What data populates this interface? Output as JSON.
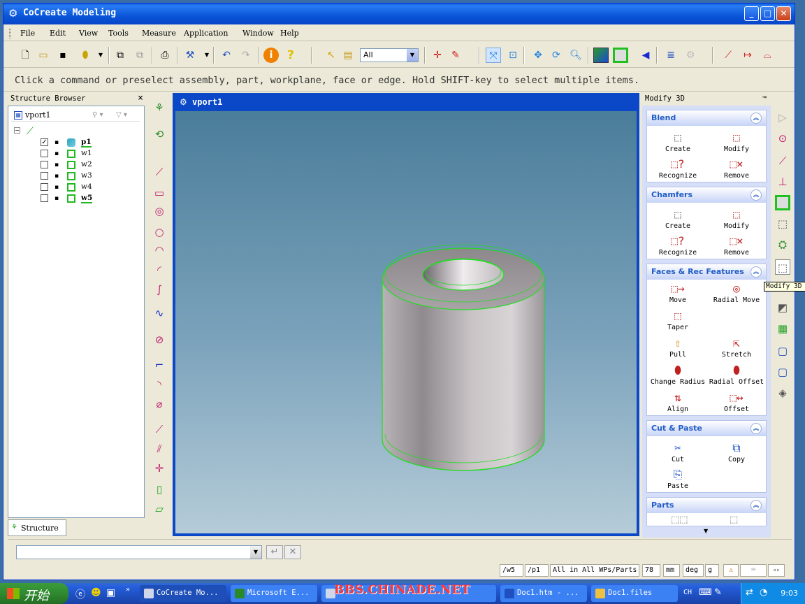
{
  "window": {
    "title": "CoCreate Modeling",
    "controls": {
      "minimize": "_",
      "maximize": "□",
      "close": "✕"
    }
  },
  "menu": [
    "File",
    "Edit",
    "View",
    "Tools",
    "Measure",
    "Application",
    "Window",
    "Help"
  ],
  "toolbar": {
    "filter_value": "All",
    "icons": [
      "new-icon",
      "open-icon",
      "save-icon",
      "cylinder-icon",
      "copy-icon",
      "paste-icon",
      "print-icon",
      "settings-icon",
      "undo-icon",
      "redo-icon",
      "info-icon",
      "help-icon",
      "select-arrow-icon",
      "select-list-icon",
      "crosshair-icon",
      "pencil-icon",
      "zoom-fit-icon",
      "zoom-box-icon",
      "pan-icon",
      "rotate-icon",
      "zoom-icon",
      "shaded-icon",
      "wireframe-icon",
      "prev-view-icon",
      "workplane-icon",
      "grid-icon",
      "line-icon",
      "dimension-icon",
      "arc-icon"
    ]
  },
  "prompt": "Click a command or preselect assembly, part, workplane, face or edge. Hold SHIFT-key to select multiple items.",
  "structure_browser": {
    "title": "Structure Browser",
    "close": "×",
    "root": "vport1",
    "items": [
      {
        "label": "p1",
        "checked": true,
        "bold": true
      },
      {
        "label": "w1",
        "checked": false,
        "bold": false
      },
      {
        "label": "w2",
        "checked": false,
        "bold": false
      },
      {
        "label": "w3",
        "checked": false,
        "bold": false
      },
      {
        "label": "w4",
        "checked": false,
        "bold": false
      },
      {
        "label": "w5",
        "checked": false,
        "bold": true
      }
    ],
    "tab": "Structure"
  },
  "viewport": {
    "title": "vport1"
  },
  "modify3d": {
    "title": "Modify 3D",
    "tooltip": "Modify 3D",
    "groups": [
      {
        "name": "Blend",
        "commands": [
          "Create",
          "Modify",
          "Recognize",
          "Remove"
        ]
      },
      {
        "name": "Chamfers",
        "commands": [
          "Create",
          "Modify",
          "Recognize",
          "Remove"
        ]
      },
      {
        "name": "Faces & Rec Features",
        "commands": [
          "Move",
          "Radial Move",
          "Taper",
          "Pull",
          "Stretch",
          "Change Radius",
          "Radial Offset",
          "Align",
          "Offset"
        ]
      },
      {
        "name": "Cut & Paste",
        "commands": [
          "Cut",
          "Copy",
          "Paste"
        ]
      },
      {
        "name": "Parts",
        "commands": []
      }
    ]
  },
  "status": {
    "wp": "/w5",
    "part": "/p1",
    "filter": "All in All WPs/Parts",
    "number": "78",
    "units_length": "mm",
    "units_angle": "deg",
    "units_mass": "g"
  },
  "taskbar": {
    "start": "开始",
    "tasks": [
      "CoCreate Mo...",
      "Microsoft E...",
      "",
      "Doc1.htm - ...",
      "Doc1.files"
    ],
    "lang": "CH",
    "clock": "9:03"
  },
  "watermark": "BBS.CHINADE.NET"
}
